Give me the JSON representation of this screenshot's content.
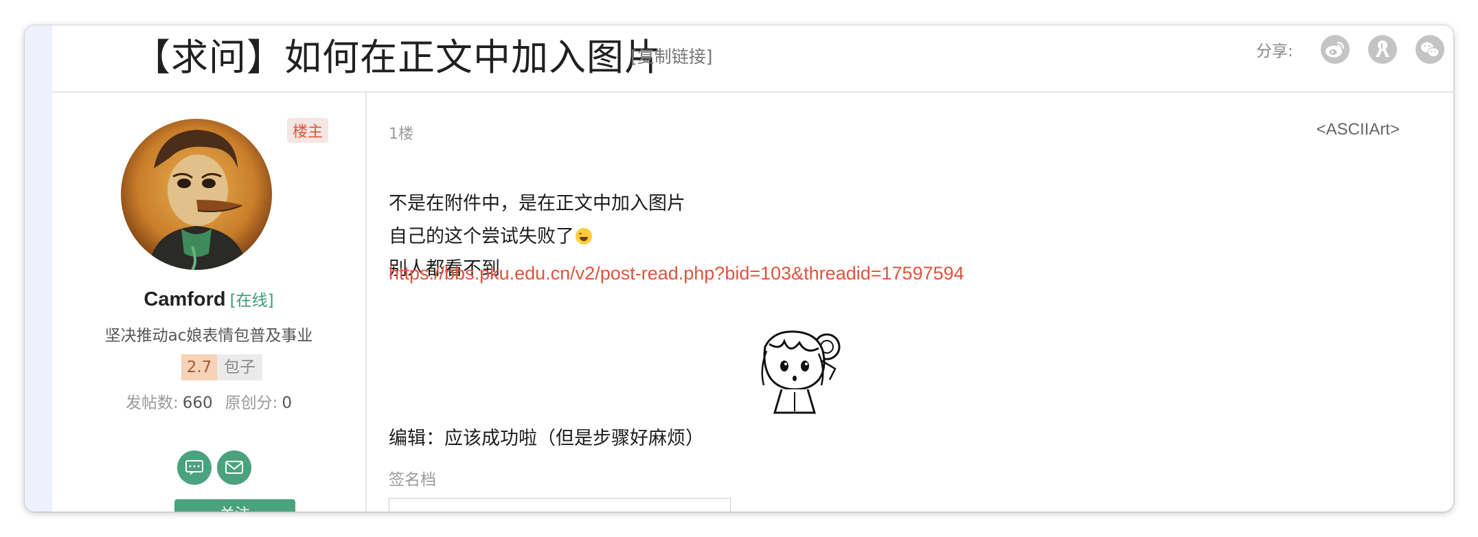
{
  "thread": {
    "title": "【求问】如何在正文中加入图片",
    "copy_link": "[复制链接]",
    "share_label": "分享:",
    "share_icons": [
      "weibo-icon",
      "renren-icon",
      "wechat-icon"
    ]
  },
  "author": {
    "badge": "楼主",
    "username": "Camford",
    "status": "[在线]",
    "signature": "坚决推动ac娘表情包普及事业",
    "rating_value": "2.7",
    "rating_unit": "包子",
    "posts_label": "发帖数:",
    "posts_count": "660",
    "original_label": "原创分:",
    "original_count": "0",
    "action_icons": [
      "message-icon",
      "mail-icon"
    ],
    "follow_label": "关注"
  },
  "post": {
    "floor": "1楼",
    "author_tag": "<ASCIIArt>",
    "lines": [
      "不是在附件中，是在正文中加入图片",
      "自己的这个尝试失败了",
      "别人都看不到"
    ],
    "emoji": "laughing-tears-emoji",
    "link": "https://bbs.pku.edu.cn/v2/post-read.php?bid=103&threadid=17597594",
    "edit_note": "编辑：应该成功啦（但是步骤好麻烦）",
    "signature_label": "签名档"
  },
  "colors": {
    "accent_green": "#4ba27e",
    "link_red": "#e0533d",
    "rating_bg": "#f7d2b7",
    "owner_badge_bg": "#f3e6e3"
  }
}
